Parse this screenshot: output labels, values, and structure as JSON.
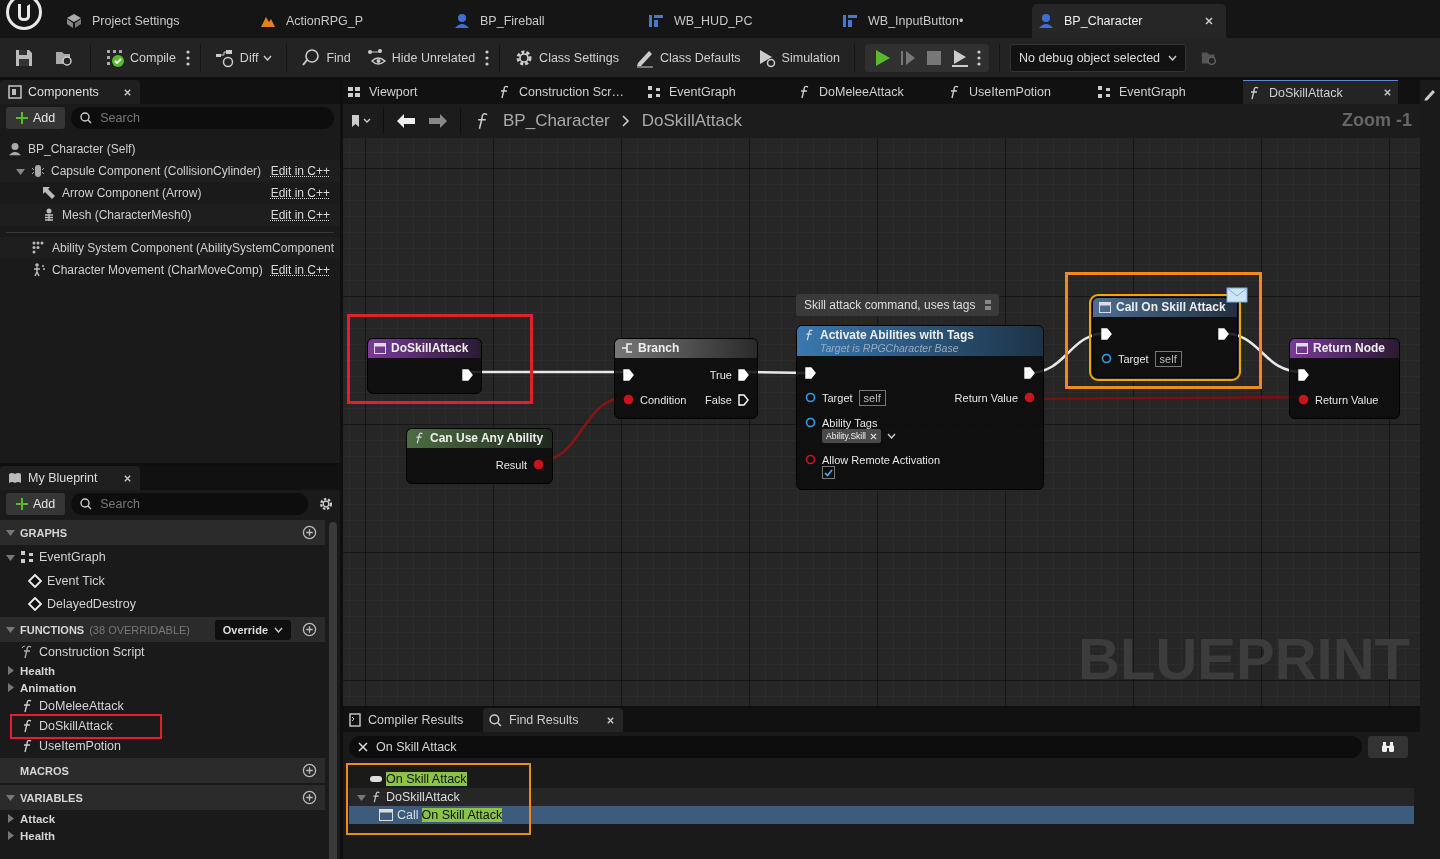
{
  "editor_tabs": [
    {
      "label": "Project Settings",
      "kind": "settings",
      "selected": false
    },
    {
      "label": "ActionRPG_P",
      "kind": "level",
      "selected": false
    },
    {
      "label": "BP_Fireball",
      "kind": "blueprint",
      "selected": false
    },
    {
      "label": "WB_HUD_PC",
      "kind": "widget",
      "selected": false
    },
    {
      "label": "WB_InputButton•",
      "kind": "widget",
      "selected": false
    },
    {
      "label": "BP_Character",
      "kind": "blueprint",
      "selected": true
    }
  ],
  "toolbar": {
    "buttons": [
      {
        "label": "Compile",
        "kind": "compile"
      },
      {
        "label": "Diff",
        "kind": "diff"
      },
      {
        "label": "Find",
        "kind": "find"
      },
      {
        "label": "Hide Unrelated",
        "kind": "hide"
      },
      {
        "label": "Class Settings",
        "kind": "class-settings"
      },
      {
        "label": "Class Defaults",
        "kind": "class-defaults"
      },
      {
        "label": "Simulation",
        "kind": "simulation"
      }
    ],
    "debug_object": "No debug object selected"
  },
  "components": {
    "title": "Components",
    "add": "Add",
    "search_placeholder": "Search",
    "root": "BP_Character (Self)",
    "inherited": [
      {
        "label": "Capsule Component (CollisionCylinder)",
        "kind": "capsule",
        "link": "Edit in C++",
        "expanded": true,
        "children": [
          {
            "label": "Arrow Component (Arrow)",
            "kind": "arrow",
            "link": "Edit in C++"
          },
          {
            "label": "Mesh (CharacterMesh0)",
            "kind": "mesh",
            "link": "Edit in C++"
          }
        ]
      }
    ],
    "added": [
      {
        "label": "Ability System Component (AbilitySystemComponent",
        "kind": "ability"
      },
      {
        "label": "Character Movement (CharMoveComp)",
        "kind": "movement",
        "link": "Edit in C++"
      }
    ]
  },
  "my_blueprint": {
    "title": "My Blueprint",
    "add": "Add",
    "search_placeholder": "Search",
    "sections": [
      {
        "title": "GRAPHS",
        "expanded": true,
        "items": [
          {
            "label": "EventGraph",
            "kind": "graph",
            "expanded": true,
            "children": [
              {
                "label": "Event Tick",
                "kind": "event"
              },
              {
                "label": "DelayedDestroy",
                "kind": "event"
              }
            ]
          }
        ]
      },
      {
        "title": "FUNCTIONS",
        "note": "(38 OVERRIDABLE)",
        "override": "Override",
        "expanded": true,
        "items": [
          {
            "label": "Construction Script",
            "kind": "construction"
          },
          {
            "label": "Health",
            "kind": "category",
            "expanded": false
          },
          {
            "label": "Animation",
            "kind": "category",
            "expanded": false
          },
          {
            "label": "DoMeleeAttack",
            "kind": "function"
          },
          {
            "label": "DoSkillAttack",
            "kind": "function",
            "color": "#e0202a"
          },
          {
            "label": "UseItemPotion",
            "kind": "function"
          }
        ]
      },
      {
        "title": "MACROS"
      },
      {
        "title": "VARIABLES",
        "expanded": true,
        "items": [
          {
            "label": "Attack",
            "kind": "category",
            "expanded": false
          },
          {
            "label": "Health",
            "kind": "category",
            "expanded": false
          }
        ]
      }
    ]
  },
  "graph_tabs": [
    {
      "label": "Viewport",
      "kind": "viewport",
      "selected": false
    },
    {
      "label": "Construction Scr…",
      "kind": "function",
      "selected": false
    },
    {
      "label": "EventGraph",
      "kind": "graph",
      "selected": false
    },
    {
      "label": "DoMeleeAttack",
      "kind": "function",
      "selected": false
    },
    {
      "label": "UseItemPotion",
      "kind": "function",
      "selected": false
    },
    {
      "label": "EventGraph",
      "kind": "graph",
      "selected": false
    },
    {
      "label": "DoSkillAttack",
      "kind": "function",
      "selected": true
    }
  ],
  "breadcrumb": [
    "BP_Character",
    "DoSkillAttack"
  ],
  "graph": {
    "zoom": "Zoom -1",
    "label": "BLUEPRINT",
    "nodes": [
      {
        "kind": "entry",
        "title": "DoSkillAttack",
        "selected": false,
        "color": "#e0202a",
        "rows": [
          {
            "out": {
              "kind": "exec",
              "connected": true
            }
          }
        ]
      },
      {
        "kind": "pure",
        "title": "Can Use Any Ability",
        "selected": false,
        "rows": [
          {
            "out": {
              "kind": "bool",
              "label": "Result",
              "connected": true
            }
          }
        ]
      },
      {
        "kind": "branch",
        "title": "Branch",
        "selected": false,
        "rows": [
          {
            "in": {
              "kind": "exec",
              "connected": true
            },
            "out": {
              "kind": "exec",
              "label": "True",
              "connected": true
            }
          },
          {
            "in": {
              "kind": "bool",
              "label": "Condition",
              "connected": true
            },
            "out": {
              "kind": "exec",
              "label": "False",
              "connected": false
            }
          }
        ]
      },
      {
        "kind": "function",
        "title": "Activate Abilities with Tags",
        "subtitle": "Target is RPGCharacter Base",
        "comment": "Skill attack command, uses tags",
        "selected": false,
        "rows": [
          {
            "in": {
              "kind": "exec",
              "connected": true
            },
            "out": {
              "kind": "exec",
              "connected": true
            }
          },
          {
            "in": {
              "kind": "object",
              "label": "Target",
              "value": "self",
              "connected": false
            },
            "out": {
              "kind": "bool",
              "label": "Return Value",
              "connected": true
            }
          },
          {
            "in": {
              "kind": "object",
              "label": "Ability Tags",
              "tags": [
                "Ability.Skill"
              ],
              "connected": false
            }
          },
          {
            "in": {
              "kind": "bool",
              "label": "Allow Remote Activation",
              "checked": true,
              "connected": false
            }
          }
        ]
      },
      {
        "kind": "message",
        "title": "Call On Skill Attack",
        "selected": true,
        "color": "#f08a1c",
        "rows": [
          {
            "in": {
              "kind": "exec",
              "connected": true
            },
            "out": {
              "kind": "exec",
              "connected": true
            }
          },
          {
            "in": {
              "kind": "object",
              "label": "Target",
              "value": "self",
              "connected": false
            }
          }
        ]
      },
      {
        "kind": "return",
        "title": "Return Node",
        "selected": false,
        "rows": [
          {
            "in": {
              "kind": "exec",
              "connected": true
            }
          },
          {
            "in": {
              "kind": "bool",
              "label": "Return Value",
              "connected": true
            }
          }
        ]
      }
    ]
  },
  "bottom_tabs": [
    {
      "label": "Compiler Results",
      "kind": "compiler",
      "selected": false
    },
    {
      "label": "Find Results",
      "kind": "find",
      "selected": true
    }
  ],
  "find": {
    "query": "On Skill Attack",
    "color": "#f08a1c",
    "results": [
      {
        "kind": "event",
        "segments": [
          {
            "text": "On Skill Attack",
            "match": true
          }
        ],
        "selected": false
      },
      {
        "kind": "function",
        "segments": [
          {
            "text": "DoSkillAttack",
            "match": false
          }
        ],
        "expanded": true,
        "selected": false,
        "children": [
          {
            "kind": "node",
            "segments": [
              {
                "text": "Call",
                "match": false
              },
              {
                "text": "On Skill Attack",
                "match": true
              }
            ],
            "selected": true
          }
        ]
      }
    ]
  }
}
